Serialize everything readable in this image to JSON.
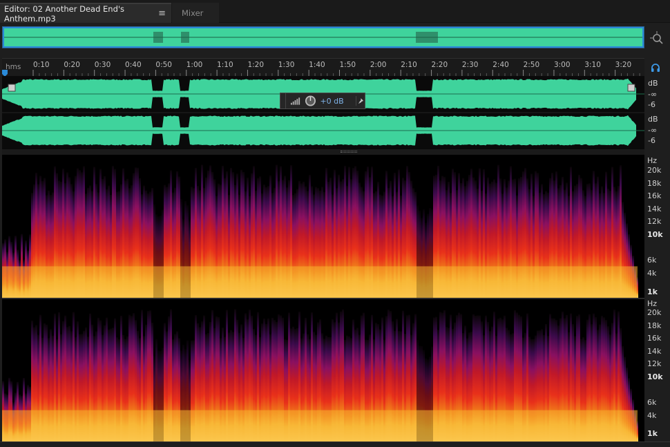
{
  "tabs": {
    "editor_label": "Editor: 02 Another Dead End's Anthem.mp3",
    "editor_menu": "≡",
    "mixer_label": "Mixer"
  },
  "ruler": {
    "unit": "hms",
    "ticks": [
      "0:10",
      "0:20",
      "0:30",
      "0:40",
      "0:50",
      "1:00",
      "1:10",
      "1:20",
      "1:30",
      "1:40",
      "1:50",
      "2:00",
      "2:10",
      "2:20",
      "2:30",
      "2:40",
      "2:50",
      "3:00",
      "3:10",
      "3:20"
    ]
  },
  "hud": {
    "value": "+0 dB"
  },
  "db_scale": {
    "top": [
      "dB",
      "-∞",
      "-6"
    ],
    "bottom": [
      "dB",
      "-∞",
      "-6"
    ]
  },
  "hz_scale": {
    "unit": "Hz",
    "labels": [
      "20k",
      "18k",
      "16k",
      "14k",
      "12k",
      "10k",
      "6k",
      "4k",
      "1k"
    ]
  },
  "colors": {
    "waveform": "#3fd39c",
    "selection": "#2a8ad8",
    "hud_value": "#7fb3e8"
  },
  "icons": {
    "zoom": "zoom-magnifier-icon",
    "headphone": "headphone-icon",
    "pin": "pin-icon",
    "knob": "volume-knob-icon"
  }
}
